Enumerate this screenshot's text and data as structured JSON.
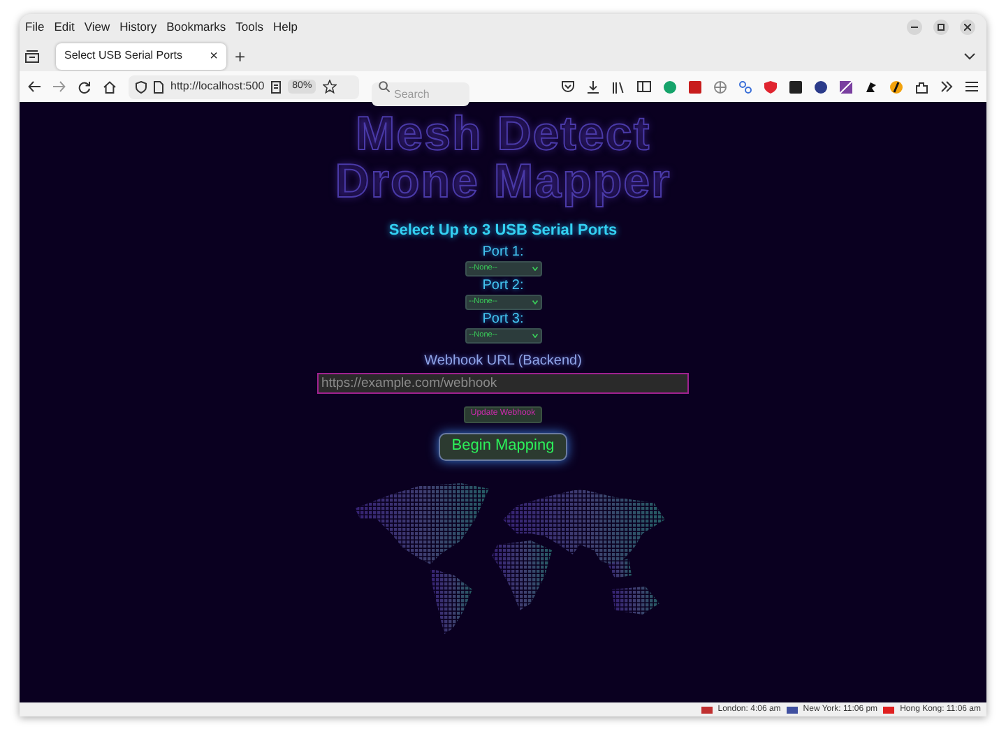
{
  "menu": [
    "File",
    "Edit",
    "View",
    "History",
    "Bookmarks",
    "Tools",
    "Help"
  ],
  "tab": {
    "title": "Select USB Serial Ports",
    "close": "×"
  },
  "new_tab": "+",
  "address": {
    "url": "http://localhost:500",
    "zoom": "80%"
  },
  "search": {
    "placeholder": "Search"
  },
  "page": {
    "title_lines": [
      "Mesh Detect",
      "Drone Mapper"
    ],
    "heading": "Select Up to 3 USB Serial Ports",
    "ports": [
      {
        "label": "Port 1:",
        "value": "--None--"
      },
      {
        "label": "Port 2:",
        "value": "--None--"
      },
      {
        "label": "Port 3:",
        "value": "--None--"
      }
    ],
    "webhook": {
      "label": "Webhook URL (Backend)",
      "placeholder": "https://example.com/webhook"
    },
    "update_button": "Update Webhook",
    "begin_button": "Begin Mapping"
  },
  "clocks": [
    {
      "text": "London: 4:06 am",
      "color": "#c03030"
    },
    {
      "text": "New York: 11:06 pm",
      "color": "#4050a0"
    },
    {
      "text": "Hong Kong: 11:06 am",
      "color": "#e02020"
    }
  ]
}
